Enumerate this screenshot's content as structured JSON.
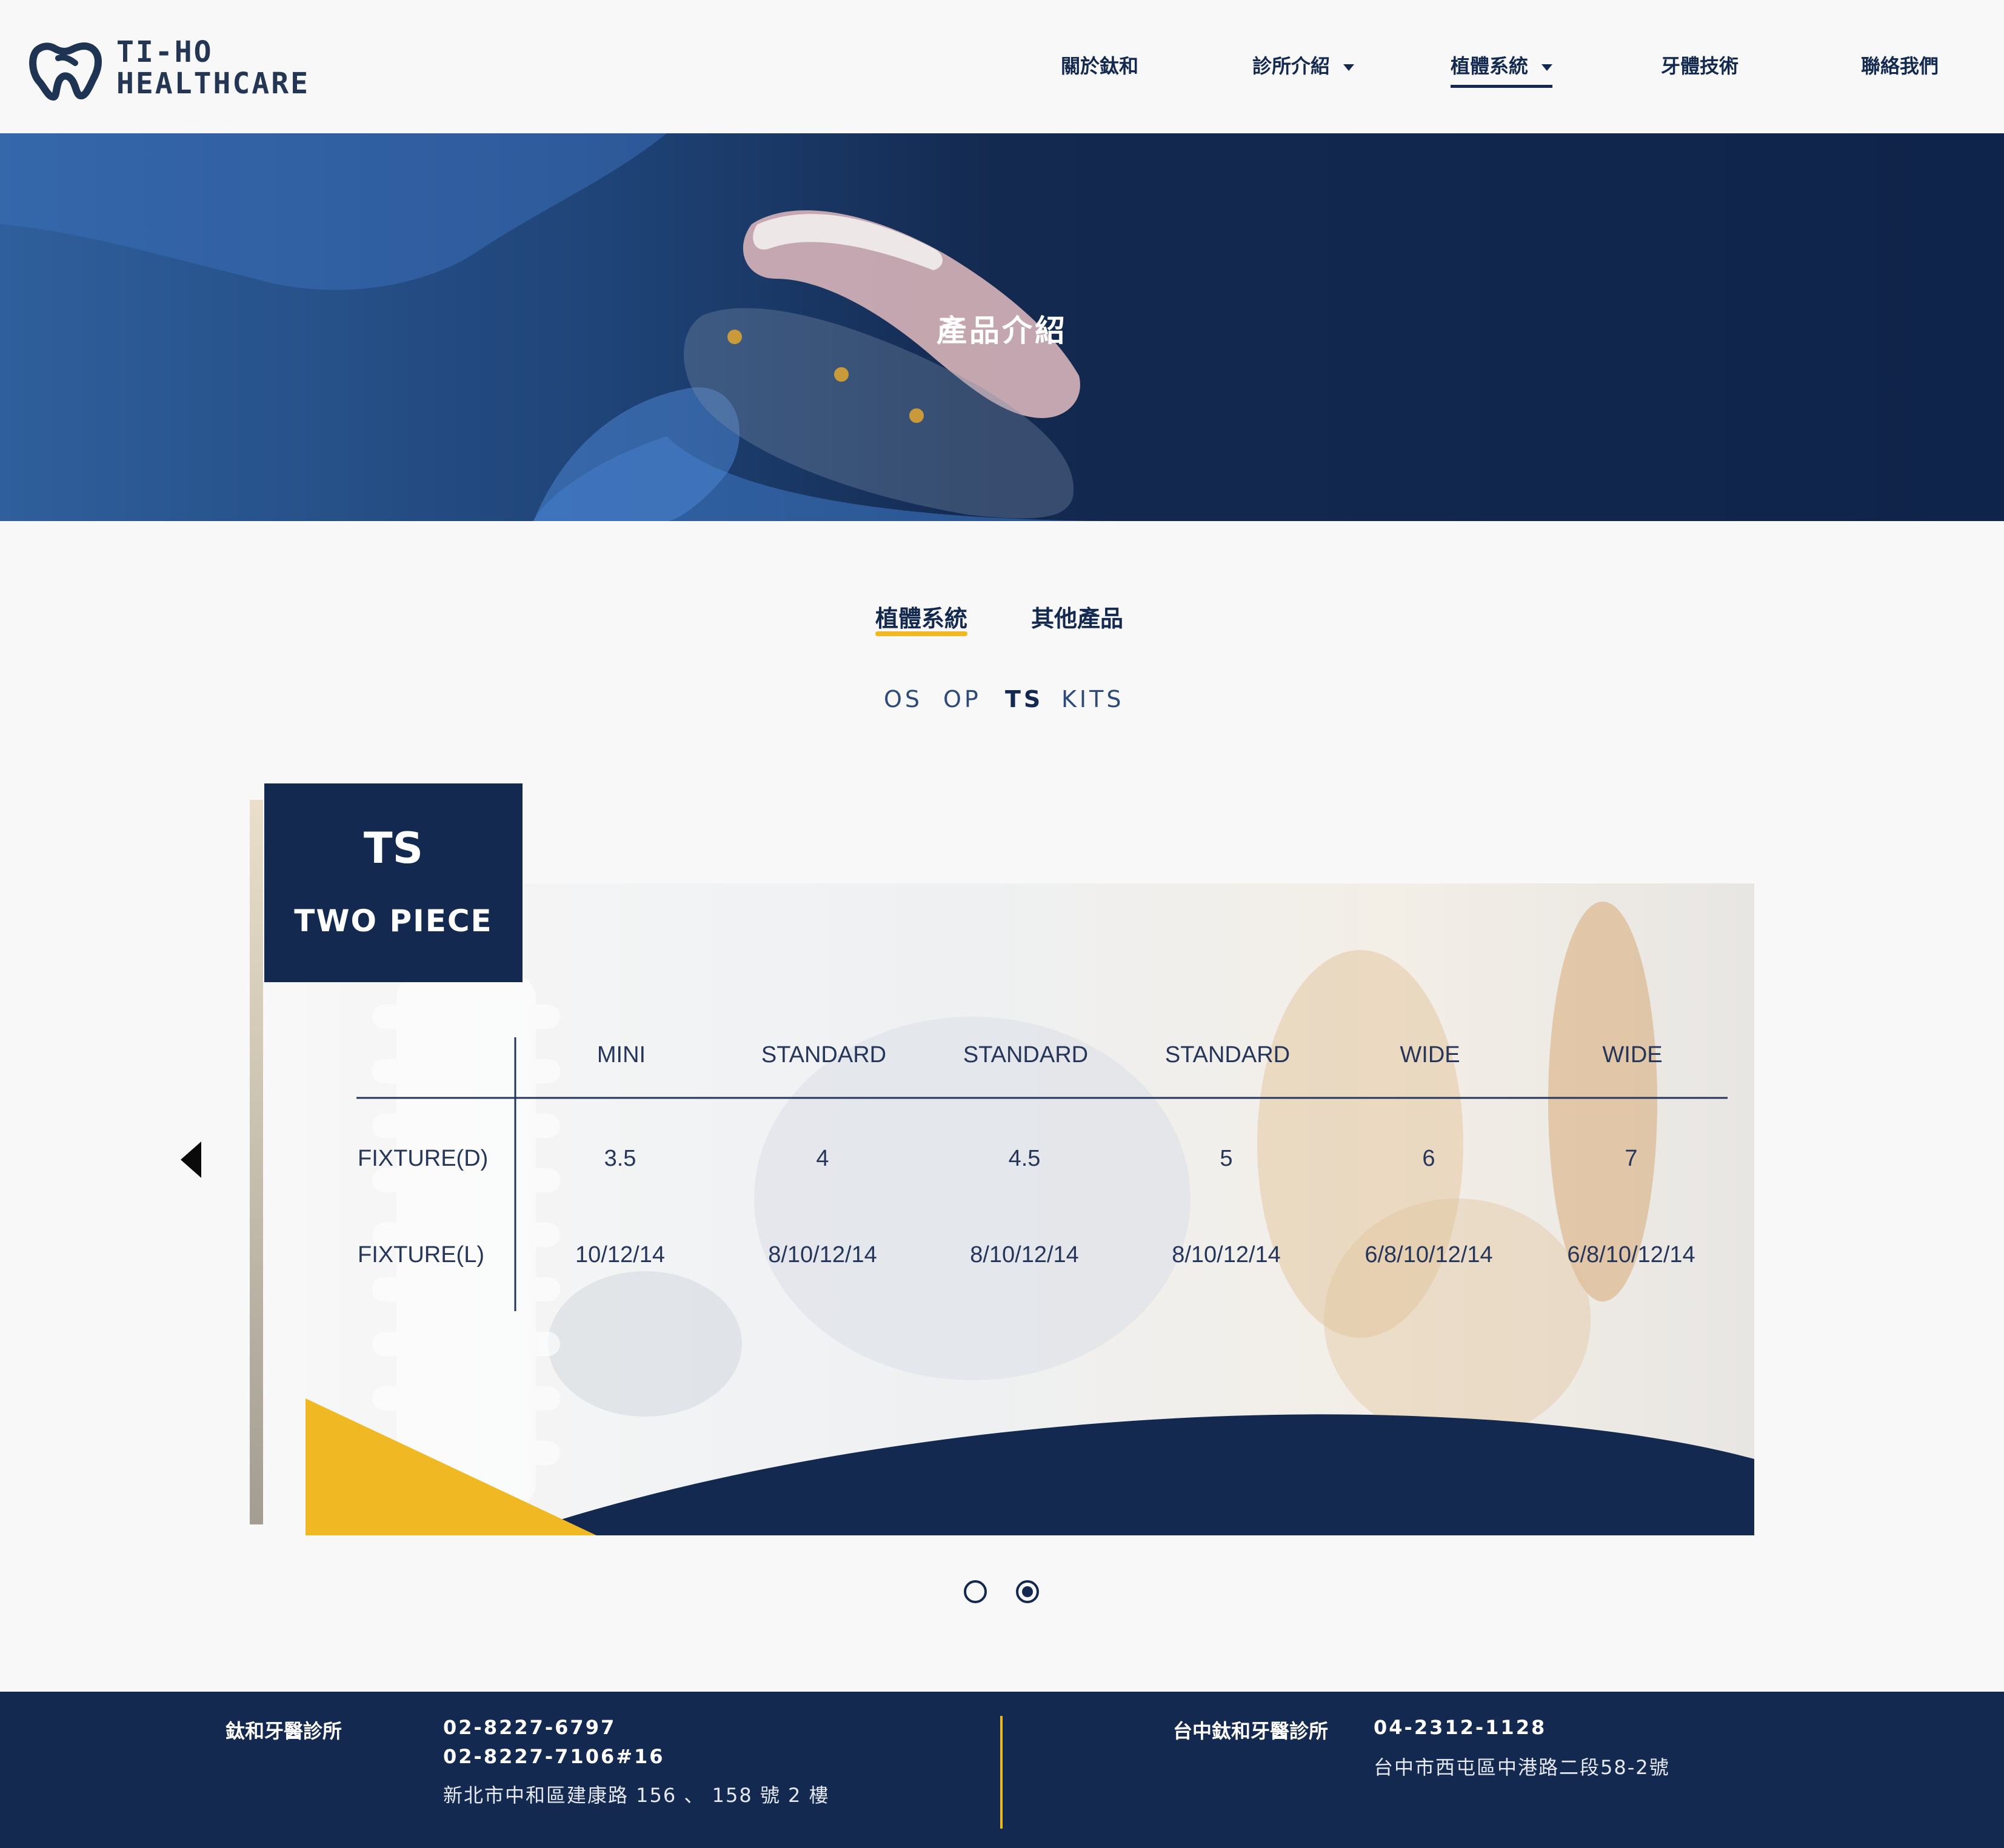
{
  "header": {
    "brand_line1": "TI-HO",
    "brand_line2": "HEALTHCARE",
    "nav": [
      {
        "label": "關於鈦和"
      },
      {
        "label": "診所介紹"
      },
      {
        "label": "植體系統"
      },
      {
        "label": "牙體技術"
      },
      {
        "label": "聯絡我們"
      }
    ]
  },
  "hero": {
    "title": "產品介紹"
  },
  "tabs": [
    {
      "label": "植體系統",
      "active": true
    },
    {
      "label": "其他產品",
      "active": false
    }
  ],
  "subtabs": [
    {
      "label": "OS"
    },
    {
      "label": "OP"
    },
    {
      "label": "TS",
      "active": true
    },
    {
      "label": "KITS"
    }
  ],
  "slide": {
    "badge_title": "TS",
    "badge_subtitle": "TWO PIECE",
    "columns": [
      "MINI",
      "STANDARD",
      "STANDARD",
      "STANDARD",
      "WIDE",
      "WIDE"
    ],
    "rows": [
      {
        "label": "FIXTURE(D)",
        "values": [
          "3.5",
          "4",
          "4.5",
          "5",
          "6",
          "7"
        ]
      },
      {
        "label": "FIXTURE(L)",
        "values": [
          "10/12/14",
          "8/10/12/14",
          "8/10/12/14",
          "8/10/12/14",
          "6/8/10/12/14",
          "6/8/10/12/14"
        ]
      }
    ]
  },
  "carousel": {
    "slides": 2,
    "active_slide": 2
  },
  "footer": {
    "clinic1": {
      "name": "鈦和牙醫診所",
      "phone1": "02-8227-6797",
      "phone2": "02-8227-7106#16",
      "address": "新北市中和區建康路 156 、 158 號 2 樓"
    },
    "clinic2": {
      "name": "台中鈦和牙醫診所",
      "phone": "04-2312-1128",
      "address": "台中市西屯區中港路二段58-2號"
    }
  },
  "colors": {
    "navy": "#14294f",
    "gold": "#f0b823",
    "background": "#f8f8f8"
  }
}
